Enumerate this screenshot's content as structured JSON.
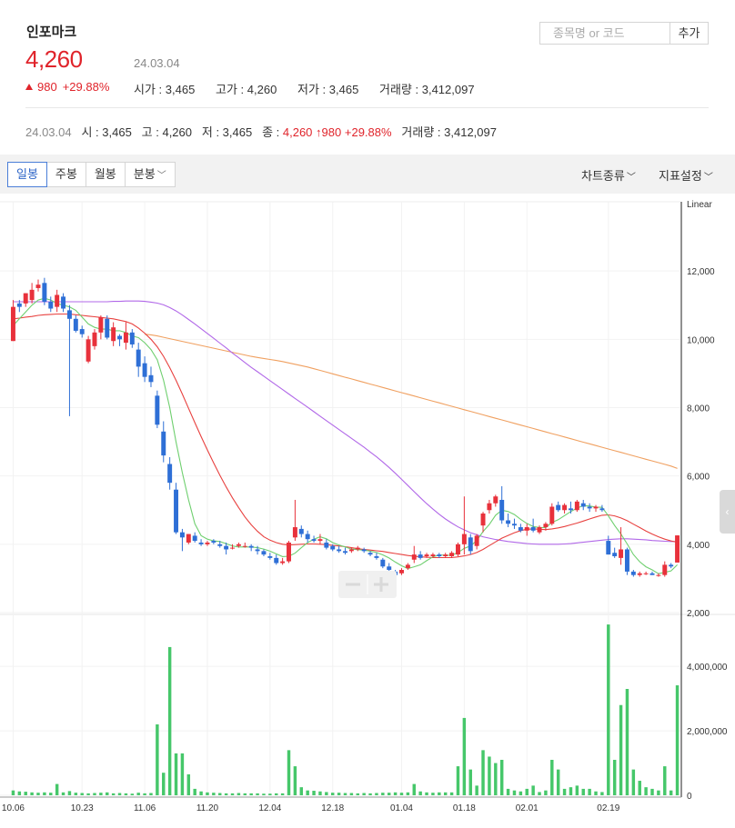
{
  "header": {
    "stock_name": "인포마크",
    "price": "4,260",
    "date": "24.03.04",
    "change": "980",
    "change_pct": "+29.88%",
    "stats": [
      {
        "label": "시가",
        "value": "3,465"
      },
      {
        "label": "고가",
        "value": "4,260"
      },
      {
        "label": "저가",
        "value": "3,465"
      },
      {
        "label": "거래량",
        "value": "3,412,097"
      }
    ]
  },
  "search": {
    "placeholder": "종목명 or 코드",
    "add_label": "추가"
  },
  "summary": {
    "date": "24.03.04",
    "open_label": "시",
    "open": "3,465",
    "high_label": "고",
    "high": "4,260",
    "low_label": "저",
    "low": "3,465",
    "close_label": "종",
    "close": "4,260",
    "change": "980",
    "change_pct": "+29.88%",
    "volume_label": "거래량",
    "volume": "3,412,097"
  },
  "tabs": [
    {
      "label": "일봉",
      "active": true
    },
    {
      "label": "주봉"
    },
    {
      "label": "월봉"
    },
    {
      "label": "분봉",
      "has_dropdown": true
    }
  ],
  "menus": {
    "chart_type": "차트종류",
    "indicator": "지표설정"
  },
  "colors": {
    "up": "#e8313b",
    "down": "#2e6fd6",
    "ma5": "#6fcf6f",
    "ma20": "#e8413f",
    "ma60": "#b168e8",
    "ma120": "#f0a060",
    "volume": "#46c76a",
    "price_red": "#e0242b"
  },
  "chart_data": {
    "type": "candlestick",
    "scale_label": "Linear",
    "price_axis": {
      "ticks": [
        "12,000",
        "10,000",
        "8,000",
        "6,000",
        "4,000",
        "2,000"
      ],
      "range": [
        2000,
        12000
      ]
    },
    "volume_axis": {
      "ticks": [
        "4,000,000",
        "2,000,000",
        "0"
      ],
      "range": [
        0,
        5500000
      ]
    },
    "x_ticks": [
      "10.06",
      "10.23",
      "11.06",
      "11.20",
      "12.04",
      "12.18",
      "01.04",
      "01.18",
      "02.01",
      "02.19"
    ],
    "candles": [
      [
        9950,
        11150,
        9950,
        10950
      ],
      [
        11050,
        11150,
        10800,
        10950
      ],
      [
        11050,
        11350,
        10950,
        11350
      ],
      [
        11150,
        11650,
        11050,
        11450
      ],
      [
        11500,
        11750,
        11400,
        11600
      ],
      [
        11650,
        11800,
        11000,
        11100
      ],
      [
        11100,
        11250,
        10800,
        10900
      ],
      [
        10950,
        11450,
        10800,
        11300
      ],
      [
        11250,
        11350,
        10800,
        10900
      ],
      [
        10850,
        11000,
        7750,
        10600
      ],
      [
        10600,
        10700,
        10200,
        10250
      ],
      [
        10300,
        10400,
        10050,
        10150
      ],
      [
        9350,
        10100,
        9300,
        10000
      ],
      [
        9800,
        10300,
        9700,
        10200
      ],
      [
        10200,
        10700,
        10000,
        10650
      ],
      [
        10600,
        10700,
        10000,
        10050
      ],
      [
        9950,
        10500,
        9800,
        10350
      ],
      [
        10100,
        10150,
        9800,
        10000
      ],
      [
        9900,
        10500,
        9700,
        10200
      ],
      [
        10200,
        10300,
        9750,
        9850
      ],
      [
        9700,
        9900,
        8900,
        9200
      ],
      [
        9300,
        9500,
        8750,
        8900
      ],
      [
        8950,
        9200,
        8600,
        8750
      ],
      [
        8350,
        8500,
        7400,
        7500
      ],
      [
        7300,
        7600,
        6400,
        6600
      ],
      [
        6350,
        6550,
        5600,
        5800
      ],
      [
        5600,
        5800,
        4300,
        4350
      ],
      [
        4350,
        4450,
        3800,
        4200
      ],
      [
        4050,
        4300,
        4000,
        4300
      ],
      [
        4250,
        4350,
        4050,
        4100
      ],
      [
        4050,
        4150,
        3950,
        4000
      ],
      [
        4000,
        4100,
        3950,
        4050
      ],
      [
        4100,
        4150,
        4000,
        4050
      ],
      [
        4000,
        4100,
        3900,
        3950
      ],
      [
        3950,
        4050,
        3700,
        3850
      ],
      [
        3900,
        4000,
        3850,
        3900
      ],
      [
        3950,
        4050,
        3900,
        4000
      ],
      [
        3950,
        4050,
        3900,
        3950
      ],
      [
        3950,
        4000,
        3800,
        3900
      ],
      [
        3850,
        3950,
        3700,
        3800
      ],
      [
        3800,
        3850,
        3650,
        3700
      ],
      [
        3650,
        3750,
        3550,
        3600
      ],
      [
        3600,
        3700,
        3400,
        3450
      ],
      [
        3450,
        3600,
        3400,
        3500
      ],
      [
        3500,
        4100,
        3450,
        4050
      ],
      [
        4200,
        5300,
        4100,
        4500
      ],
      [
        4450,
        4550,
        4200,
        4300
      ],
      [
        4300,
        4400,
        4050,
        4150
      ],
      [
        4150,
        4250,
        4050,
        4100
      ],
      [
        4100,
        4300,
        4000,
        4150
      ],
      [
        4050,
        4150,
        3850,
        3900
      ],
      [
        3950,
        4000,
        3800,
        3850
      ],
      [
        3850,
        3950,
        3750,
        3800
      ],
      [
        3800,
        3900,
        3700,
        3750
      ],
      [
        3800,
        3900,
        3750,
        3850
      ],
      [
        3850,
        3950,
        3800,
        3900
      ],
      [
        3850,
        3900,
        3750,
        3800
      ],
      [
        3750,
        3800,
        3650,
        3700
      ],
      [
        3650,
        3750,
        3550,
        3600
      ],
      [
        3550,
        3600,
        3300,
        3350
      ],
      [
        3350,
        3450,
        3200,
        3250
      ],
      [
        3200,
        3250,
        3050,
        3100
      ],
      [
        3150,
        3300,
        3100,
        3250
      ],
      [
        3300,
        3450,
        3250,
        3400
      ],
      [
        3550,
        3950,
        3450,
        3700
      ],
      [
        3700,
        3800,
        3550,
        3600
      ],
      [
        3650,
        3750,
        3600,
        3700
      ],
      [
        3650,
        3750,
        3600,
        3700
      ],
      [
        3700,
        3750,
        3600,
        3650
      ],
      [
        3650,
        3750,
        3600,
        3700
      ],
      [
        3650,
        3800,
        3600,
        3750
      ],
      [
        3700,
        4050,
        3650,
        4000
      ],
      [
        4000,
        5400,
        3700,
        4300
      ],
      [
        4200,
        4300,
        3700,
        3800
      ],
      [
        3950,
        4300,
        3850,
        4250
      ],
      [
        4550,
        4950,
        4350,
        4900
      ],
      [
        5000,
        5300,
        4900,
        5200
      ],
      [
        5200,
        5450,
        5100,
        5400
      ],
      [
        5300,
        5700,
        4600,
        4700
      ],
      [
        4700,
        4900,
        4500,
        4600
      ],
      [
        4600,
        4750,
        4450,
        4550
      ],
      [
        4500,
        4600,
        4350,
        4400
      ],
      [
        4400,
        4600,
        4250,
        4500
      ],
      [
        4500,
        4750,
        4350,
        4400
      ],
      [
        4350,
        4550,
        4300,
        4500
      ],
      [
        4500,
        4650,
        4400,
        4600
      ],
      [
        4600,
        5200,
        4550,
        5100
      ],
      [
        5150,
        5250,
        4950,
        5000
      ],
      [
        5000,
        5200,
        4900,
        5150
      ],
      [
        5050,
        5250,
        4900,
        5000
      ],
      [
        5000,
        5300,
        4950,
        5250
      ],
      [
        5200,
        5300,
        5000,
        5100
      ],
      [
        5100,
        5200,
        4950,
        5050
      ],
      [
        5050,
        5150,
        4950,
        5100
      ],
      [
        5050,
        5150,
        4950,
        5000
      ],
      [
        4100,
        4250,
        3700,
        3700
      ],
      [
        3750,
        3900,
        3600,
        3650
      ],
      [
        3600,
        4500,
        3400,
        3850
      ],
      [
        3850,
        3900,
        3100,
        3200
      ],
      [
        3200,
        3250,
        3050,
        3100
      ],
      [
        3100,
        3200,
        3050,
        3150
      ],
      [
        3150,
        3200,
        3100,
        3150
      ],
      [
        3150,
        3200,
        3100,
        3100
      ],
      [
        3100,
        3150,
        3050,
        3100
      ],
      [
        3100,
        3500,
        3050,
        3400
      ],
      [
        3400,
        3450,
        3300,
        3350
      ],
      [
        3465,
        4260,
        3465,
        4260
      ]
    ],
    "volumes": [
      150000,
      120000,
      110000,
      90000,
      80000,
      90000,
      80000,
      350000,
      90000,
      130000,
      80000,
      70000,
      60000,
      70000,
      80000,
      90000,
      60000,
      70000,
      60000,
      50000,
      80000,
      60000,
      70000,
      2200000,
      700000,
      4600000,
      1300000,
      1300000,
      650000,
      200000,
      120000,
      90000,
      80000,
      70000,
      60000,
      60000,
      70000,
      60000,
      60000,
      60000,
      50000,
      50000,
      60000,
      60000,
      1400000,
      900000,
      250000,
      150000,
      140000,
      120000,
      100000,
      80000,
      80000,
      70000,
      70000,
      60000,
      70000,
      60000,
      70000,
      80000,
      80000,
      90000,
      80000,
      90000,
      350000,
      120000,
      90000,
      80000,
      90000,
      90000,
      90000,
      900000,
      2400000,
      800000,
      300000,
      1400000,
      1200000,
      1000000,
      1100000,
      200000,
      150000,
      120000,
      200000,
      300000,
      100000,
      150000,
      1100000,
      800000,
      200000,
      250000,
      300000,
      200000,
      200000,
      120000,
      100000,
      5300000,
      1100000,
      2800000,
      3300000,
      800000,
      450000,
      250000,
      200000,
      150000,
      900000,
      150000,
      3412097
    ],
    "ma5": [
      10400,
      10600,
      10800,
      11000,
      11150,
      11200,
      11150,
      11050,
      11000,
      10950,
      10850,
      10650,
      10450,
      10350,
      10300,
      10300,
      10250,
      10250,
      10200,
      10100,
      10050,
      9900,
      9700,
      9400,
      8800,
      8000,
      7000,
      6100,
      5300,
      4600,
      4250,
      4150,
      4100,
      4080,
      4020,
      3950,
      3920,
      3920,
      3920,
      3900,
      3860,
      3800,
      3720,
      3640,
      3650,
      3740,
      3900,
      4050,
      4150,
      4220,
      4160,
      4050,
      3980,
      3920,
      3860,
      3840,
      3830,
      3800,
      3760,
      3690,
      3600,
      3480,
      3370,
      3290,
      3340,
      3400,
      3520,
      3630,
      3690,
      3680,
      3680,
      3760,
      3880,
      3950,
      4110,
      4370,
      4580,
      4850,
      5000,
      4960,
      4870,
      4730,
      4610,
      4520,
      4490,
      4490,
      4640,
      4720,
      4840,
      4960,
      5060,
      5130,
      5120,
      5090,
      5080,
      4830,
      4550,
      4300,
      4010,
      3700,
      3490,
      3340,
      3250,
      3140,
      3180,
      3220,
      3400
    ],
    "ma20": [
      10600,
      10620,
      10650,
      10670,
      10700,
      10720,
      10730,
      10740,
      10740,
      10740,
      10720,
      10700,
      10680,
      10660,
      10640,
      10620,
      10600,
      10560,
      10520,
      10450,
      10330,
      10180,
      10000,
      9780,
      9500,
      9170,
      8800,
      8400,
      7980,
      7560,
      7150,
      6760,
      6380,
      6020,
      5680,
      5360,
      5070,
      4800,
      4570,
      4380,
      4220,
      4120,
      4050,
      4000,
      3980,
      3990,
      4000,
      4010,
      4010,
      4000,
      3990,
      3970,
      3950,
      3930,
      3900,
      3870,
      3850,
      3830,
      3810,
      3790,
      3760,
      3730,
      3700,
      3670,
      3650,
      3630,
      3620,
      3610,
      3610,
      3610,
      3610,
      3630,
      3660,
      3700,
      3760,
      3850,
      3960,
      4070,
      4180,
      4260,
      4340,
      4400,
      4440,
      4450,
      4440,
      4430,
      4450,
      4480,
      4520,
      4570,
      4620,
      4680,
      4740,
      4800,
      4850,
      4860,
      4830,
      4770,
      4690,
      4590,
      4490,
      4390,
      4300,
      4220,
      4150,
      4100,
      4060
    ],
    "ma60": [
      11100,
      11100,
      11100,
      11100,
      11100,
      11100,
      11100,
      11100,
      11100,
      11100,
      11100,
      11100,
      11100,
      11100,
      11100,
      11100,
      11110,
      11110,
      11120,
      11120,
      11120,
      11110,
      11090,
      11060,
      11010,
      10930,
      10830,
      10710,
      10580,
      10450,
      10310,
      10170,
      10030,
      9890,
      9750,
      9600,
      9460,
      9320,
      9180,
      9050,
      8920,
      8790,
      8660,
      8530,
      8400,
      8270,
      8140,
      8010,
      7880,
      7750,
      7620,
      7490,
      7360,
      7230,
      7100,
      6970,
      6840,
      6700,
      6560,
      6410,
      6250,
      6080,
      5900,
      5720,
      5540,
      5360,
      5190,
      5030,
      4880,
      4740,
      4620,
      4510,
      4420,
      4340,
      4280,
      4220,
      4180,
      4140,
      4110,
      4080,
      4060,
      4040,
      4020,
      4010,
      4000,
      4000,
      4000,
      4000,
      4010,
      4020,
      4040,
      4060,
      4080,
      4100,
      4120,
      4140,
      4150,
      4160,
      4160,
      4150,
      4140,
      4130,
      4110,
      4100,
      4090,
      4080,
      4080
    ],
    "ma120": [
      null,
      null,
      null,
      null,
      null,
      null,
      null,
      null,
      null,
      null,
      null,
      null,
      null,
      null,
      null,
      null,
      null,
      null,
      null,
      null,
      null,
      10150,
      10130,
      10100,
      10060,
      10020,
      9980,
      9940,
      9900,
      9860,
      9820,
      9780,
      9740,
      9700,
      9660,
      9620,
      9580,
      9540,
      9500,
      9470,
      9440,
      9410,
      9380,
      9350,
      9310,
      9270,
      9230,
      9190,
      9140,
      9090,
      9040,
      8990,
      8940,
      8890,
      8840,
      8790,
      8740,
      8690,
      8640,
      8590,
      8540,
      8490,
      8440,
      8390,
      8340,
      8290,
      8240,
      8190,
      8140,
      8090,
      8040,
      7990,
      7940,
      7890,
      7840,
      7790,
      7740,
      7690,
      7640,
      7590,
      7540,
      7490,
      7440,
      7390,
      7340,
      7290,
      7240,
      7190,
      7140,
      7090,
      7040,
      6990,
      6940,
      6890,
      6840,
      6790,
      6740,
      6690,
      6640,
      6590,
      6540,
      6490,
      6440,
      6390,
      6340,
      6290,
      6220
    ]
  }
}
